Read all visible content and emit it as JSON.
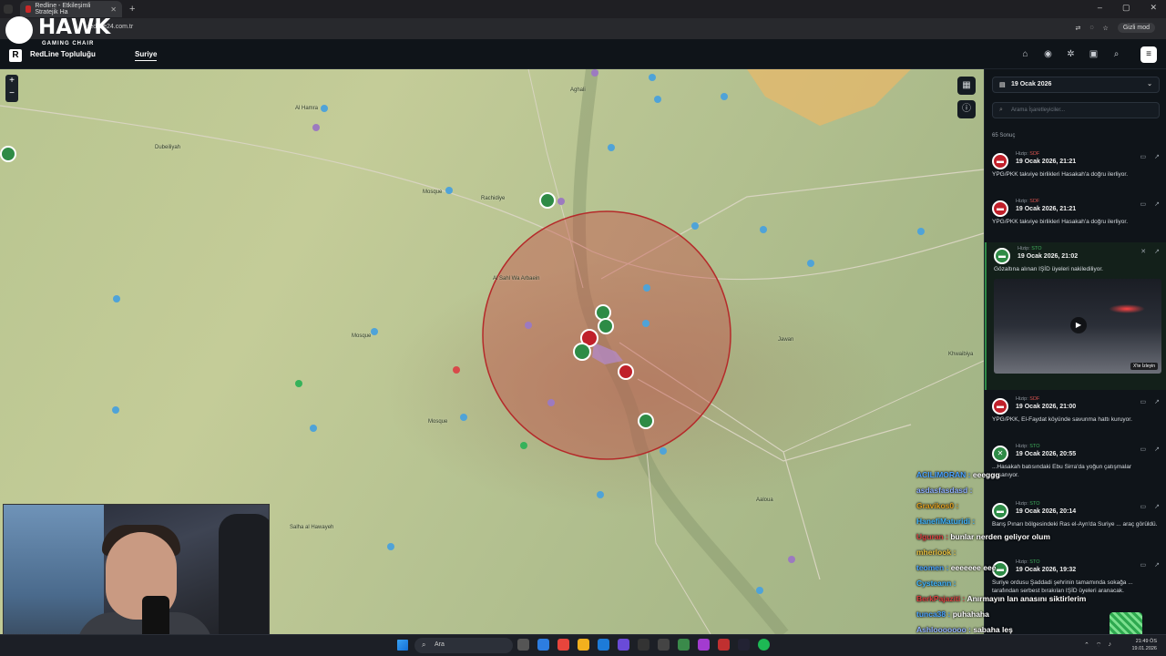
{
  "browser": {
    "tab_title": "Redline - Etkileşimli Stratejik Ha",
    "url": "redline24.com.tr",
    "incognito_label": "Gizli mod"
  },
  "overlay_logo": {
    "title": "HAWK",
    "subtitle": "GAMING CHAIR"
  },
  "app": {
    "logo_letter": "R",
    "brand_name": "RedLine Topluluğu",
    "nav_active": "Suriye",
    "header_icons": [
      "tag-icon",
      "pin-icon",
      "settings-icon",
      "camera-icon",
      "search-icon"
    ],
    "menu_icon": "menu-icon"
  },
  "map": {
    "zoom_in": "+",
    "zoom_out": "−",
    "labels": [
      {
        "t": "Al Hamra"
      },
      {
        "t": "Dubeiliyah"
      },
      {
        "t": "Rachidiye"
      },
      {
        "t": "Al Sahl Wa Arbaein"
      },
      {
        "t": "Jawan"
      },
      {
        "t": "Khwaibiya"
      },
      {
        "t": "Aaloua"
      },
      {
        "t": "Salha al Hawayeh"
      },
      {
        "t": "Aghali"
      },
      {
        "t": "Mosque"
      },
      {
        "t": "Mosque"
      },
      {
        "t": "Mosque"
      }
    ]
  },
  "panel": {
    "date_label": "19 Ocak 2026",
    "search_placeholder": "Arama İşaretleyiciler...",
    "result_count": "65 Sonuç",
    "events": [
      {
        "source_prefix": "Hizip:",
        "source": "SDF",
        "color": "red",
        "time": "19 Ocak 2026, 21:21",
        "text": "YPG/PKK takviye birlikleri Hasakah'a doğru ilerliyor."
      },
      {
        "source_prefix": "Hizip:",
        "source": "SDF",
        "color": "red",
        "time": "19 Ocak 2026, 21:21",
        "text": "YPG/PKK takviye birlikleri Hasakah'a doğru ilerliyor."
      },
      {
        "source_prefix": "Hizip:",
        "source": "STO",
        "color": "green",
        "time": "19 Ocak 2026, 21:02",
        "text": "Gözaltına alınan IŞİD üyeleri nakilediliyor.",
        "video_label": "X'te İzleyin"
      },
      {
        "source_prefix": "Hizip:",
        "source": "SDF",
        "color": "red",
        "time": "19 Ocak 2026, 21:00",
        "text": "YPG/PKK, El-Faydat köyünde savunma hattı kuruyor."
      },
      {
        "source_prefix": "Hizip:",
        "source": "STO",
        "color": "green",
        "time": "19 Ocak 2026, 20:55",
        "text": "...Hasakah batısındaki Ebu Sirra'da yoğun çatışmalar yaşanıyor."
      },
      {
        "source_prefix": "Hizip:",
        "source": "STO",
        "color": "green",
        "time": "19 Ocak 2026, 20:14",
        "text": "Barış Pınarı bölgesindeki Ras el-Ayn'da Suriye ... araç görüldü."
      },
      {
        "source_prefix": "Hizip:",
        "source": "STO",
        "color": "green",
        "time": "19 Ocak 2026, 19:32",
        "text": "Suriye ordusu Şaddadi şehrinin tamamında sokağa ... tarafından serbest bırakılan IŞİD üyeleri aranacak."
      }
    ]
  },
  "chat": [
    {
      "user": "ACILIMORAN :",
      "msg": "eeeggg",
      "color": "#4aa3ff"
    },
    {
      "user": "asdasfasdasd :",
      "msg": "",
      "color": "#8fb0ff"
    },
    {
      "user": "Gravikos0 :",
      "msg": "",
      "color": "#e0a020"
    },
    {
      "user": "HanefiMaturidi :",
      "msg": "",
      "color": "#3fb6ff"
    },
    {
      "user": "Uguran :",
      "msg": "bunlar nerden geliyor olum",
      "color": "#d94040"
    },
    {
      "user": "mherlook :",
      "msg": "",
      "color": "#e8c040"
    },
    {
      "user": "teomen :",
      "msg": "eeeeeee eee",
      "color": "#4aa3ff"
    },
    {
      "user": "Cysteann :",
      "msg": "",
      "color": "#3fb6ff"
    },
    {
      "user": "BerkPajaziti :",
      "msg": "Anırmayın lan anasını siktirlerim",
      "color": "#d94040"
    },
    {
      "user": "tunca38 :",
      "msg": "puhahaha",
      "color": "#4aa3ff"
    },
    {
      "user": "Ashlooooooo :",
      "msg": "sabaha leş",
      "color": "#8fb0ff"
    }
  ],
  "taskbar": {
    "search_label": "Ara",
    "time": "21:49 ÖS",
    "date": "19.01.2026"
  }
}
